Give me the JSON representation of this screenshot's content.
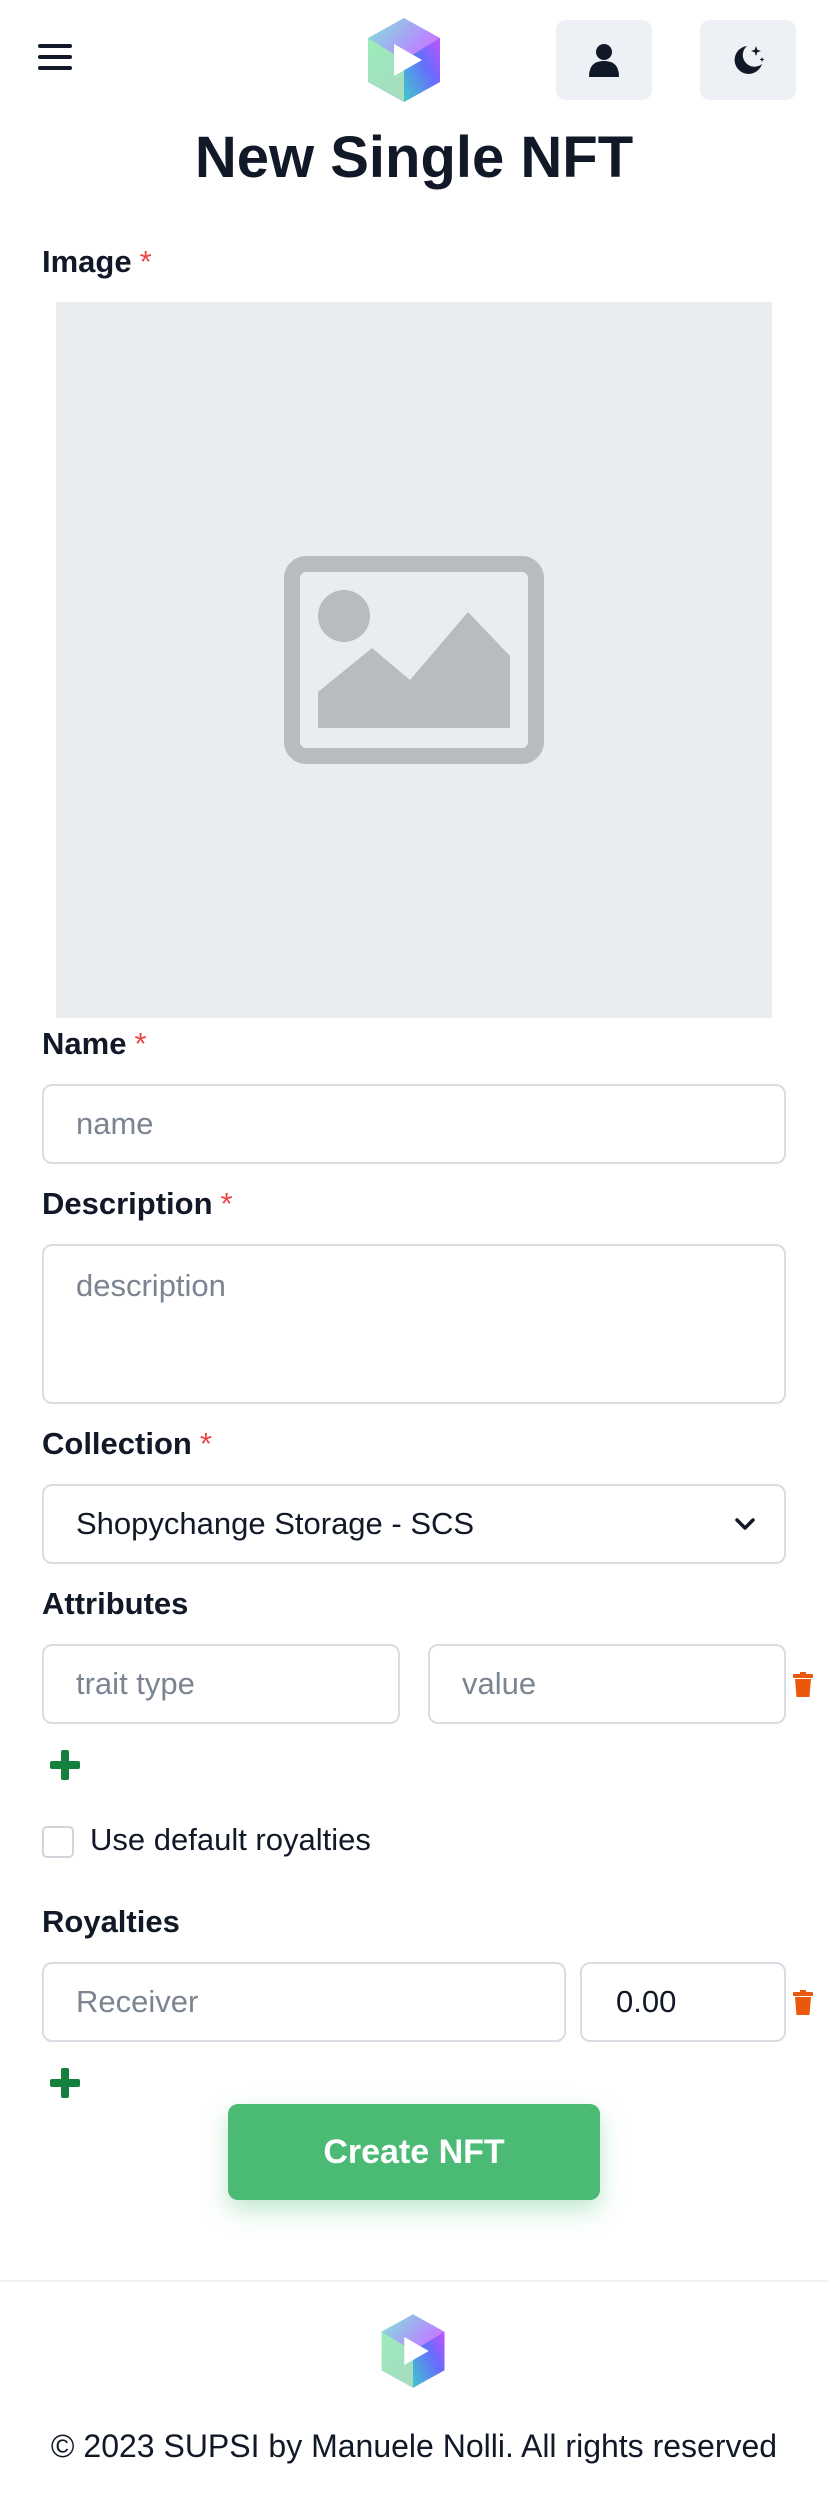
{
  "header": {
    "menu_icon": "hamburger-menu-icon",
    "logo_icon": "supsi-cube-logo",
    "user_icon": "user-icon",
    "theme_icon": "moon-stars-icon"
  },
  "page": {
    "title": "New Single NFT"
  },
  "form": {
    "image_label": "Image",
    "required_mark": "*",
    "image_icon": "image-placeholder-icon",
    "name_label": "Name",
    "name_placeholder": "name",
    "description_label": "Description",
    "description_placeholder": "description",
    "collection_label": "Collection",
    "collection_selected": "Shopychange Storage - SCS",
    "attributes_label": "Attributes",
    "trait_type_placeholder": "trait type",
    "value_placeholder": "value",
    "use_default_royalties_label": "Use default royalties",
    "use_default_royalties_checked": false,
    "royalties_label": "Royalties",
    "receiver_placeholder": "Receiver",
    "royalty_value": "0.00",
    "create_button": "Create NFT"
  },
  "colors": {
    "accent_green": "#4aba74",
    "plus_green": "#15803d",
    "delete_orange": "#ea580c",
    "required_red": "#ef4444"
  },
  "footer": {
    "copyright": "© 2023 SUPSI by Manuele Nolli. All rights reserved"
  }
}
